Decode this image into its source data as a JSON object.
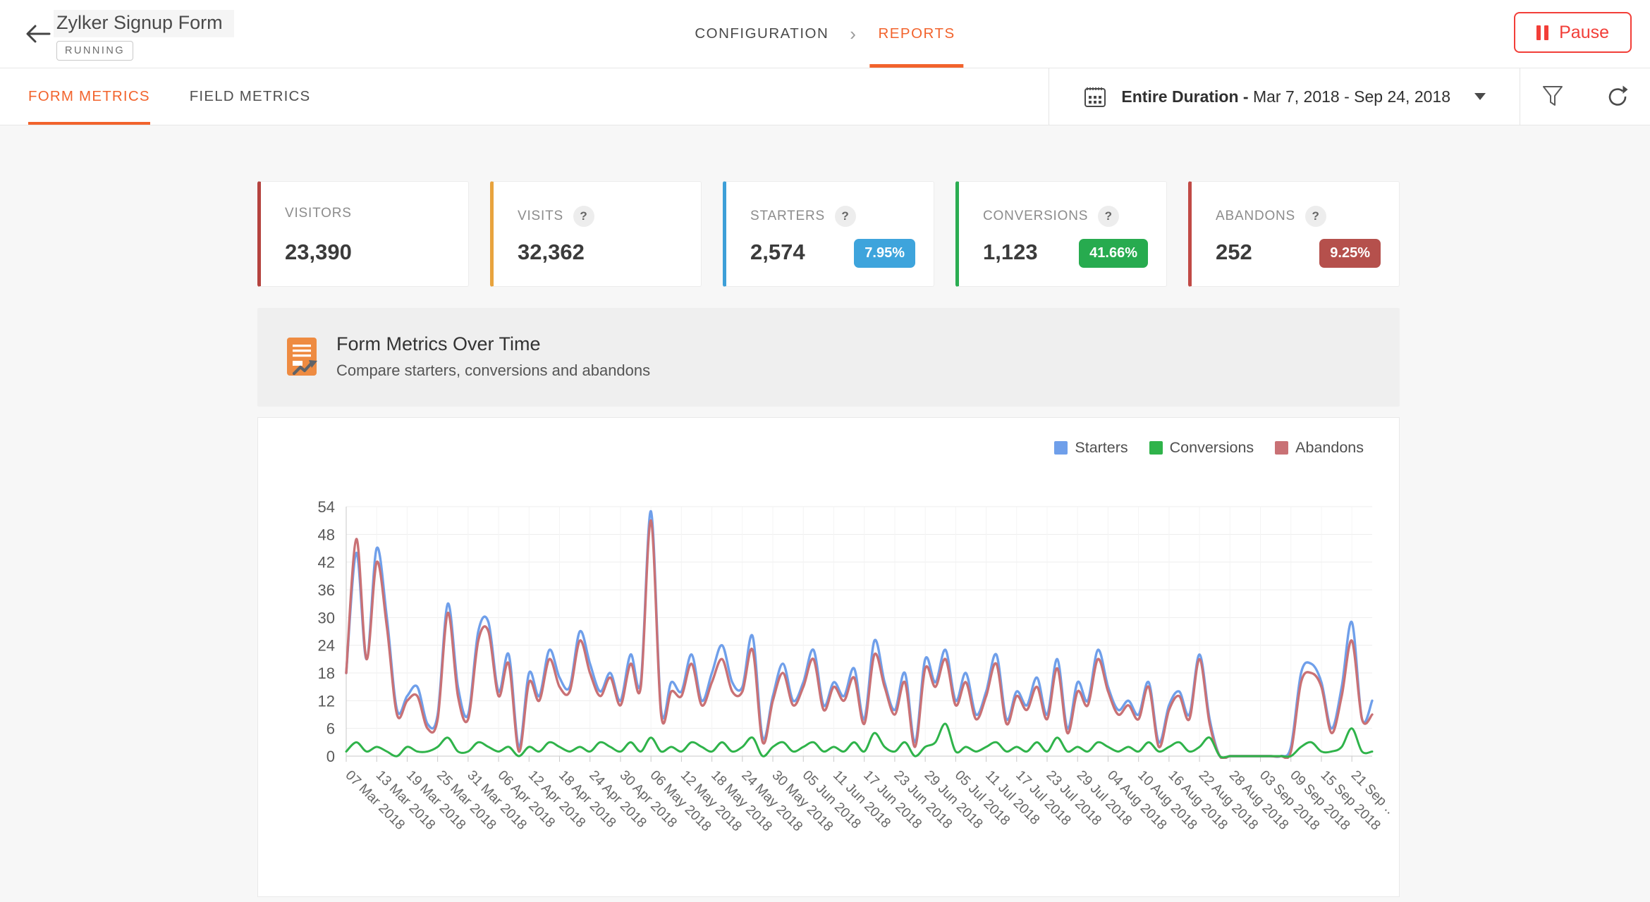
{
  "header": {
    "title": "Zylker Signup Form",
    "status": "RUNNING",
    "breadcrumb": {
      "configuration": "CONFIGURATION",
      "separator": "›",
      "reports": "REPORTS"
    },
    "pause_label": "Pause"
  },
  "tabs": {
    "form_metrics": "FORM METRICS",
    "field_metrics": "FIELD METRICS"
  },
  "toolbar": {
    "date_range_bold": "Entire Duration -",
    "date_range": " Mar 7, 2018 - Sep 24, 2018"
  },
  "icons": {
    "back": "arrow-left",
    "pause": "pause-bars",
    "date": "calendar",
    "caret": "triangle-down",
    "filter": "funnel",
    "refresh": "circular-arrow",
    "help": "?",
    "section": "document-with-trend-arrow"
  },
  "cards": [
    {
      "label": "VISITORS",
      "value": "23,390",
      "accent": "#b5433f",
      "help": "?"
    },
    {
      "label": "VISITS",
      "value": "32,362",
      "accent": "#e8a33d",
      "help": "?"
    },
    {
      "label": "STARTERS",
      "value": "2,574",
      "accent": "#3d9fd8",
      "help": "?",
      "badge": "7.95%",
      "badge_color": "#3ea4dc"
    },
    {
      "label": "CONVERSIONS",
      "value": "1,123",
      "accent": "#2bad52",
      "help": "?",
      "badge": "41.66%",
      "badge_color": "#27ab4f"
    },
    {
      "label": "ABANDONS",
      "value": "252",
      "accent": "#c14a46",
      "help": "?",
      "badge": "9.25%",
      "badge_color": "#b5504c"
    }
  ],
  "section": {
    "title": "Form Metrics Over Time",
    "subtitle": "Compare starters, conversions and abandons"
  },
  "chart_data": {
    "type": "line",
    "title": "Form Metrics Over Time",
    "ylim": [
      0,
      54
    ],
    "y_ticks": [
      0,
      6,
      12,
      18,
      24,
      30,
      36,
      42,
      48,
      54
    ],
    "grid": true,
    "legend_position": "top-right",
    "x_ticks_every_points": 3,
    "x_tick_labels": [
      "07 Mar 2018",
      "13 Mar 2018",
      "19 Mar 2018",
      "25 Mar 2018",
      "31 Mar 2018",
      "06 Apr 2018",
      "12 Apr 2018",
      "18 Apr 2018",
      "24 Apr 2018",
      "30 Apr 2018",
      "06 May 2018",
      "12 May 2018",
      "18 May 2018",
      "24 May 2018",
      "30 May 2018",
      "05 Jun 2018",
      "11 Jun 2018",
      "17 Jun 2018",
      "23 Jun 2018",
      "29 Jun 2018",
      "05 Jul 2018",
      "11 Jul 2018",
      "17 Jul 2018",
      "23 Jul 2018",
      "29 Jul 2018",
      "04 Aug 2018",
      "10 Aug 2018",
      "16 Aug 2018",
      "22 Aug 2018",
      "28 Aug 2018",
      "03 Sep 2018",
      "09 Sep 2018",
      "15 Sep 2018",
      "21 Sep .."
    ],
    "series": [
      {
        "name": "Starters",
        "color": "#6f9fea",
        "values": [
          18,
          44,
          21,
          45,
          30,
          10,
          13,
          15,
          7,
          9,
          33,
          15,
          9,
          27,
          29,
          14,
          22,
          2,
          18,
          13,
          23,
          17,
          15,
          27,
          20,
          14,
          18,
          12,
          22,
          16,
          53,
          10,
          16,
          14,
          22,
          12,
          18,
          24,
          16,
          15,
          26,
          4,
          13,
          20,
          12,
          16,
          23,
          11,
          16,
          13,
          19,
          8,
          25,
          16,
          10,
          18,
          3,
          21,
          16,
          23,
          12,
          18,
          9,
          14,
          22,
          8,
          14,
          11,
          17,
          9,
          21,
          6,
          16,
          12,
          23,
          15,
          10,
          12,
          9,
          16,
          3,
          11,
          14,
          9,
          22,
          8,
          0,
          0,
          0,
          0,
          0,
          0,
          0,
          2,
          18,
          20,
          16,
          6,
          15,
          29,
          8,
          12
        ]
      },
      {
        "name": "Conversions",
        "color": "#2fb34a",
        "values": [
          1,
          3,
          1,
          2,
          1,
          0,
          2,
          1,
          1,
          2,
          4,
          1,
          1,
          3,
          2,
          1,
          2,
          0,
          2,
          1,
          3,
          2,
          1,
          2,
          1,
          3,
          2,
          1,
          3,
          1,
          4,
          1,
          2,
          1,
          3,
          2,
          1,
          3,
          1,
          2,
          4,
          0,
          2,
          3,
          1,
          2,
          3,
          1,
          2,
          1,
          3,
          1,
          5,
          2,
          1,
          3,
          0,
          2,
          3,
          7,
          1,
          2,
          1,
          2,
          3,
          1,
          2,
          1,
          3,
          1,
          4,
          1,
          2,
          1,
          3,
          2,
          1,
          2,
          1,
          3,
          1,
          2,
          3,
          1,
          2,
          4,
          0,
          0,
          0,
          0,
          0,
          0,
          0,
          0,
          2,
          3,
          1,
          1,
          2,
          6,
          1,
          1
        ]
      },
      {
        "name": "Abandons",
        "color": "#c97175",
        "values": [
          18,
          47,
          21,
          42,
          28,
          9,
          12,
          13,
          6,
          8,
          31,
          13,
          8,
          25,
          27,
          13,
          20,
          1,
          16,
          12,
          21,
          15,
          14,
          25,
          18,
          13,
          17,
          11,
          20,
          15,
          51,
          9,
          14,
          13,
          20,
          11,
          16,
          21,
          14,
          14,
          23,
          3,
          12,
          18,
          11,
          15,
          21,
          10,
          15,
          12,
          17,
          7,
          22,
          15,
          9,
          16,
          2,
          19,
          15,
          21,
          11,
          16,
          8,
          13,
          20,
          7,
          13,
          10,
          15,
          8,
          19,
          5,
          14,
          11,
          21,
          14,
          9,
          11,
          8,
          15,
          2,
          10,
          13,
          8,
          21,
          7,
          0,
          0,
          0,
          0,
          0,
          0,
          0,
          1,
          16,
          18,
          15,
          5,
          13,
          25,
          8,
          9
        ]
      }
    ]
  }
}
